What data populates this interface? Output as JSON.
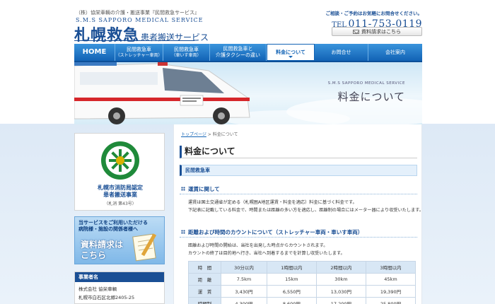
{
  "header": {
    "tagline": "（株）協栄車輌の介護・搬送事業『民間救急サービス』",
    "roman_name": "S.M.S SAPPORO MEDICAL SERVICE",
    "logo_main": "札幌救急",
    "logo_sub": "患者搬送サービス",
    "contact_note": "ご相談・ご予約はお気軽にお問合せください。",
    "tel_label": "TEL",
    "tel_number": "011-753-0119",
    "doc_request": "資料請求はこちら"
  },
  "nav": {
    "items": [
      {
        "label": "HOME",
        "sub": ""
      },
      {
        "label": "民間救急車",
        "sub": "（ストレッチャー車両）"
      },
      {
        "label": "民間救急車",
        "sub": "（車いす車両）"
      },
      {
        "label": "民間救急車と",
        "sub": "介護タクシーの違い"
      },
      {
        "label": "料金について",
        "sub": ""
      },
      {
        "label": "お問合せ",
        "sub": ""
      },
      {
        "label": "会社案内",
        "sub": ""
      }
    ],
    "active_index": 4
  },
  "hero": {
    "title_en": "S.M.S SAPPORO MEDICAL SERVICE",
    "title_jp": "料金について"
  },
  "sidebar": {
    "badge_line1": "札幌市消防局認定",
    "badge_line2": "患者搬送事業",
    "badge_line3": "（札消 第43号）",
    "request_line1": "当サービスをご利用いただける",
    "request_line2": "病院様・施設の関係者様へ",
    "request_big1": "資料請求は",
    "request_big2": "こちら",
    "biz_heading": "事業者名",
    "biz_company": "株式会社 協栄車輌",
    "biz_address": "札幌市白石区北郷2405-25"
  },
  "main": {
    "breadcrumb_home": "トップページ",
    "breadcrumb_sep": " > ",
    "breadcrumb_current": "料金について",
    "page_title": "料金について",
    "section_title": "民間救急車",
    "sub1_title": "運賃に関して",
    "sub1_p1": "運賃は国土交通省が定める（札幌圏A地区運賃・料金を適応）料金に基づく料金です。",
    "sub1_p2": "下記表に記載している料金で、時間または距離の多い方を適応し、距離制の場合にはメーター器により収受いたします。",
    "sub2_title": "距離および時間のカウントについて（ストレッチャー車両・車いす車両）",
    "sub2_p1": "距離および時間の開始は、当社を出発した時点からカウントされます。",
    "sub2_p2": "カウントの終了は目的地へ行き、当社へ到着するまでを計算し収受いたします。",
    "table": {
      "headers": [
        "時　間",
        "30分以内",
        "1時間以内",
        "2時間以内",
        "3時間以内"
      ],
      "rows": [
        [
          "距　離",
          "7.5km",
          "15km",
          "30km",
          "45km"
        ],
        [
          "運　賃",
          "3,430円",
          "6,550円",
          "13,030円",
          "19,390円"
        ],
        [
          "時間制",
          "4,300円",
          "8,600円",
          "17,200円",
          "25,800円"
        ]
      ]
    }
  }
}
